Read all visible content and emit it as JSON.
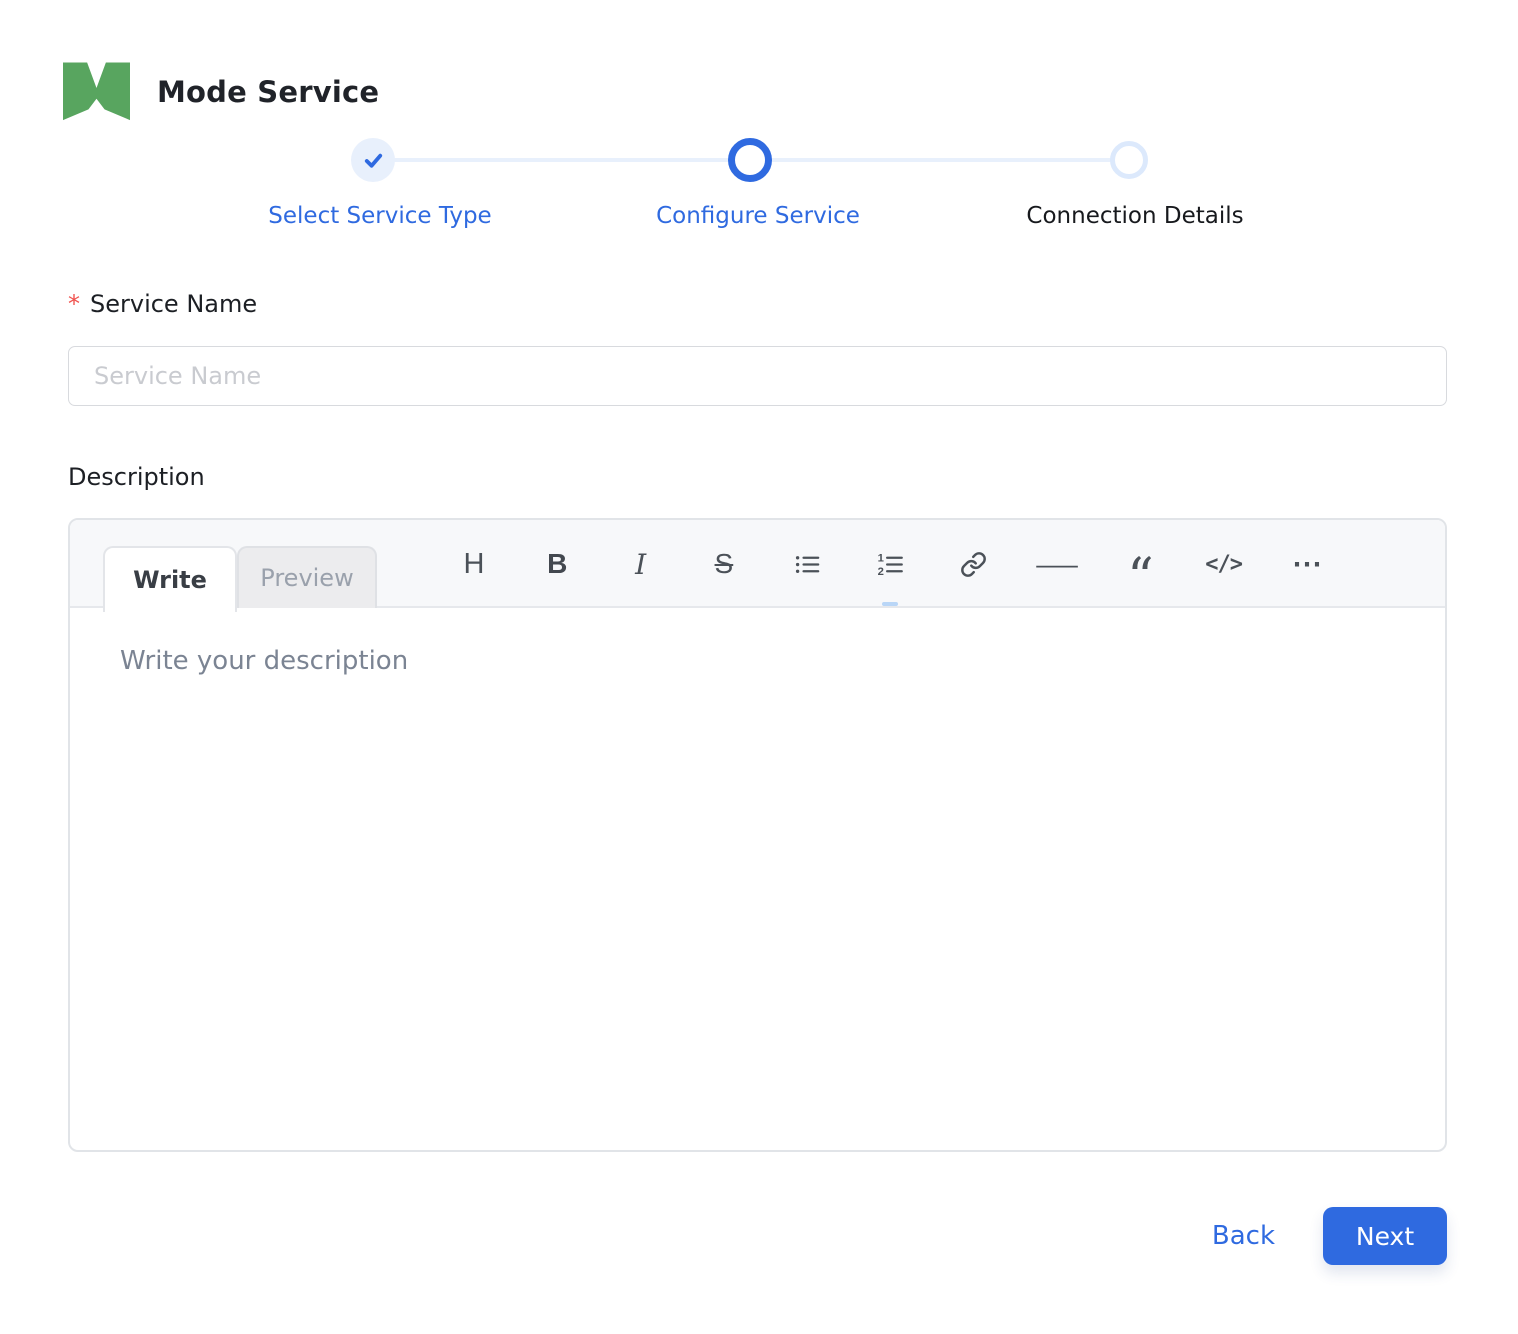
{
  "header": {
    "title": "Mode Service",
    "logo": "mode-m-logo"
  },
  "stepper": {
    "steps": [
      {
        "label": "Select Service Type",
        "state": "completed"
      },
      {
        "label": "Configure Service",
        "state": "active"
      },
      {
        "label": "Connection Details",
        "state": "upcoming"
      }
    ]
  },
  "form": {
    "service_name": {
      "label": "Service Name",
      "required_marker": "*",
      "value": "",
      "placeholder": "Service Name"
    },
    "description": {
      "label": "Description",
      "editor": {
        "tabs": [
          {
            "label": "Write",
            "active": true
          },
          {
            "label": "Preview",
            "active": false
          }
        ],
        "toolbar_icons": [
          "heading",
          "bold",
          "italic",
          "strikethrough",
          "unordered-list",
          "ordered-list",
          "link",
          "horizontal-rule",
          "quote",
          "code",
          "more"
        ],
        "value": "",
        "placeholder": "Write your description"
      }
    }
  },
  "footer": {
    "back_label": "Back",
    "next_label": "Next"
  },
  "colors": {
    "accent_blue": "#2F6AE0",
    "step_light_blue": "#E8F0FC",
    "upcoming_ring_blue": "#DCE9FC",
    "logo_green": "#58A55F",
    "required_red": "#F0524E"
  }
}
